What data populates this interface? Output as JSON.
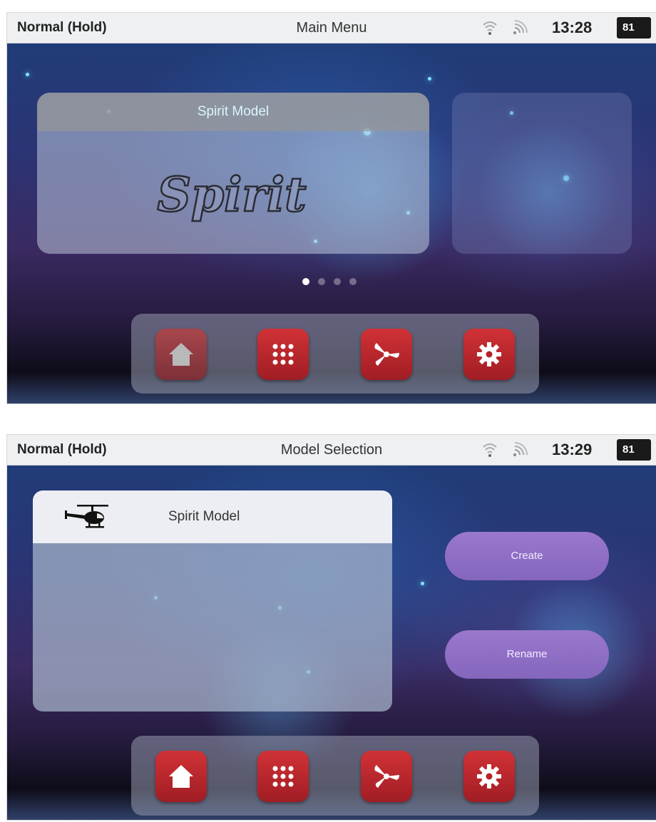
{
  "screen1": {
    "status": {
      "mode": "Normal (Hold)",
      "title": "Main Menu",
      "time": "13:28",
      "battery": "81"
    },
    "card": {
      "label": "Spirit Model",
      "logo_text": "Spirit"
    },
    "pager": {
      "pages": 4,
      "active": 1
    }
  },
  "screen2": {
    "status": {
      "mode": "Normal (Hold)",
      "title": "Model Selection",
      "time": "13:29",
      "battery": "81"
    },
    "models": [
      {
        "label": "Spirit Model",
        "icon": "helicopter-icon"
      }
    ],
    "buttons": {
      "create": "Create",
      "rename": "Rename"
    }
  },
  "dock": {
    "items": [
      {
        "icon": "home-icon"
      },
      {
        "icon": "apps-grid-icon"
      },
      {
        "icon": "propeller-icon"
      },
      {
        "icon": "gear-icon"
      }
    ]
  },
  "colors": {
    "accent_red": "#c0272d",
    "button_purple": "#8e6fc4",
    "statusbar": "#eef0f2"
  }
}
